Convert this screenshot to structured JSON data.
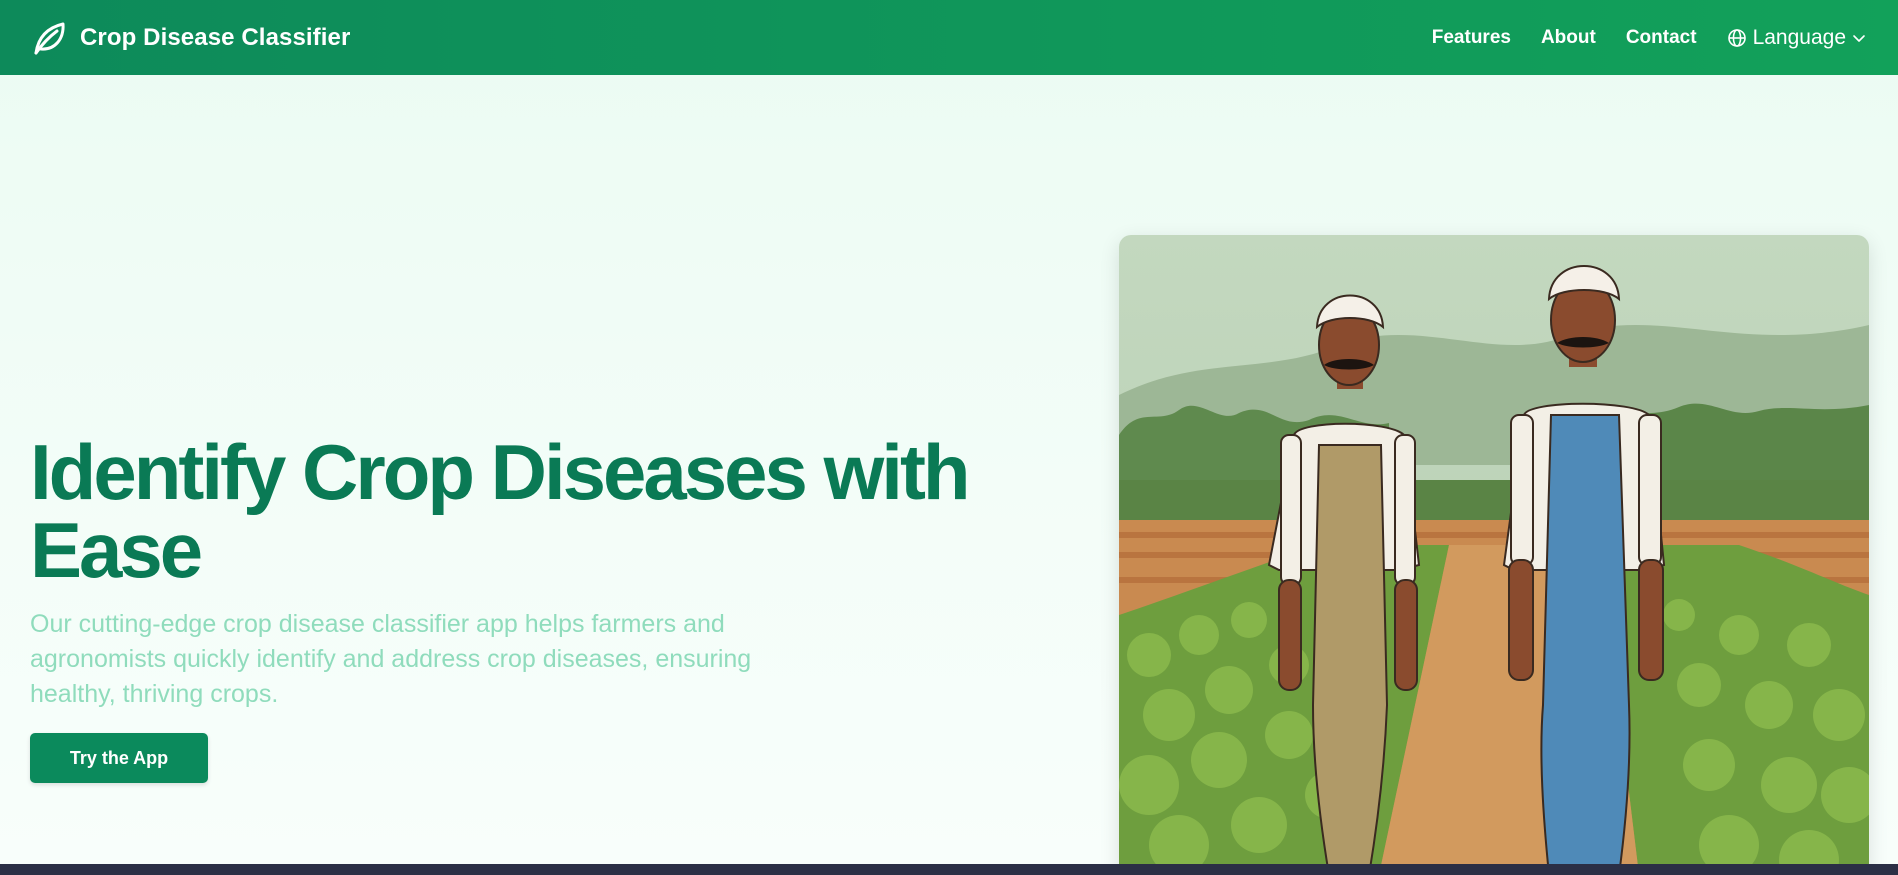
{
  "header": {
    "brand": "Crop Disease Classifier",
    "logo_icon": "leaf-icon",
    "nav": [
      {
        "label": "Features"
      },
      {
        "label": "About"
      },
      {
        "label": "Contact"
      }
    ],
    "language": {
      "label": "Language",
      "icon": "globe-icon",
      "caret_icon": "chevron-down-icon"
    }
  },
  "hero": {
    "title": "Identify Crop Diseases with Ease",
    "subtitle": "Our cutting-edge crop disease classifier app helps farmers and agronomists quickly identify and address crop diseases, ensuring healthy, thriving crops.",
    "cta_label": "Try the App",
    "image": "illustration-two-farmers-in-crop-field"
  },
  "colors": {
    "nav_start": "#0d8a5a",
    "nav_end": "#12a15a",
    "title": "#0a7a55",
    "subtitle": "#8fdcbc",
    "button": "#0b8a5c"
  }
}
